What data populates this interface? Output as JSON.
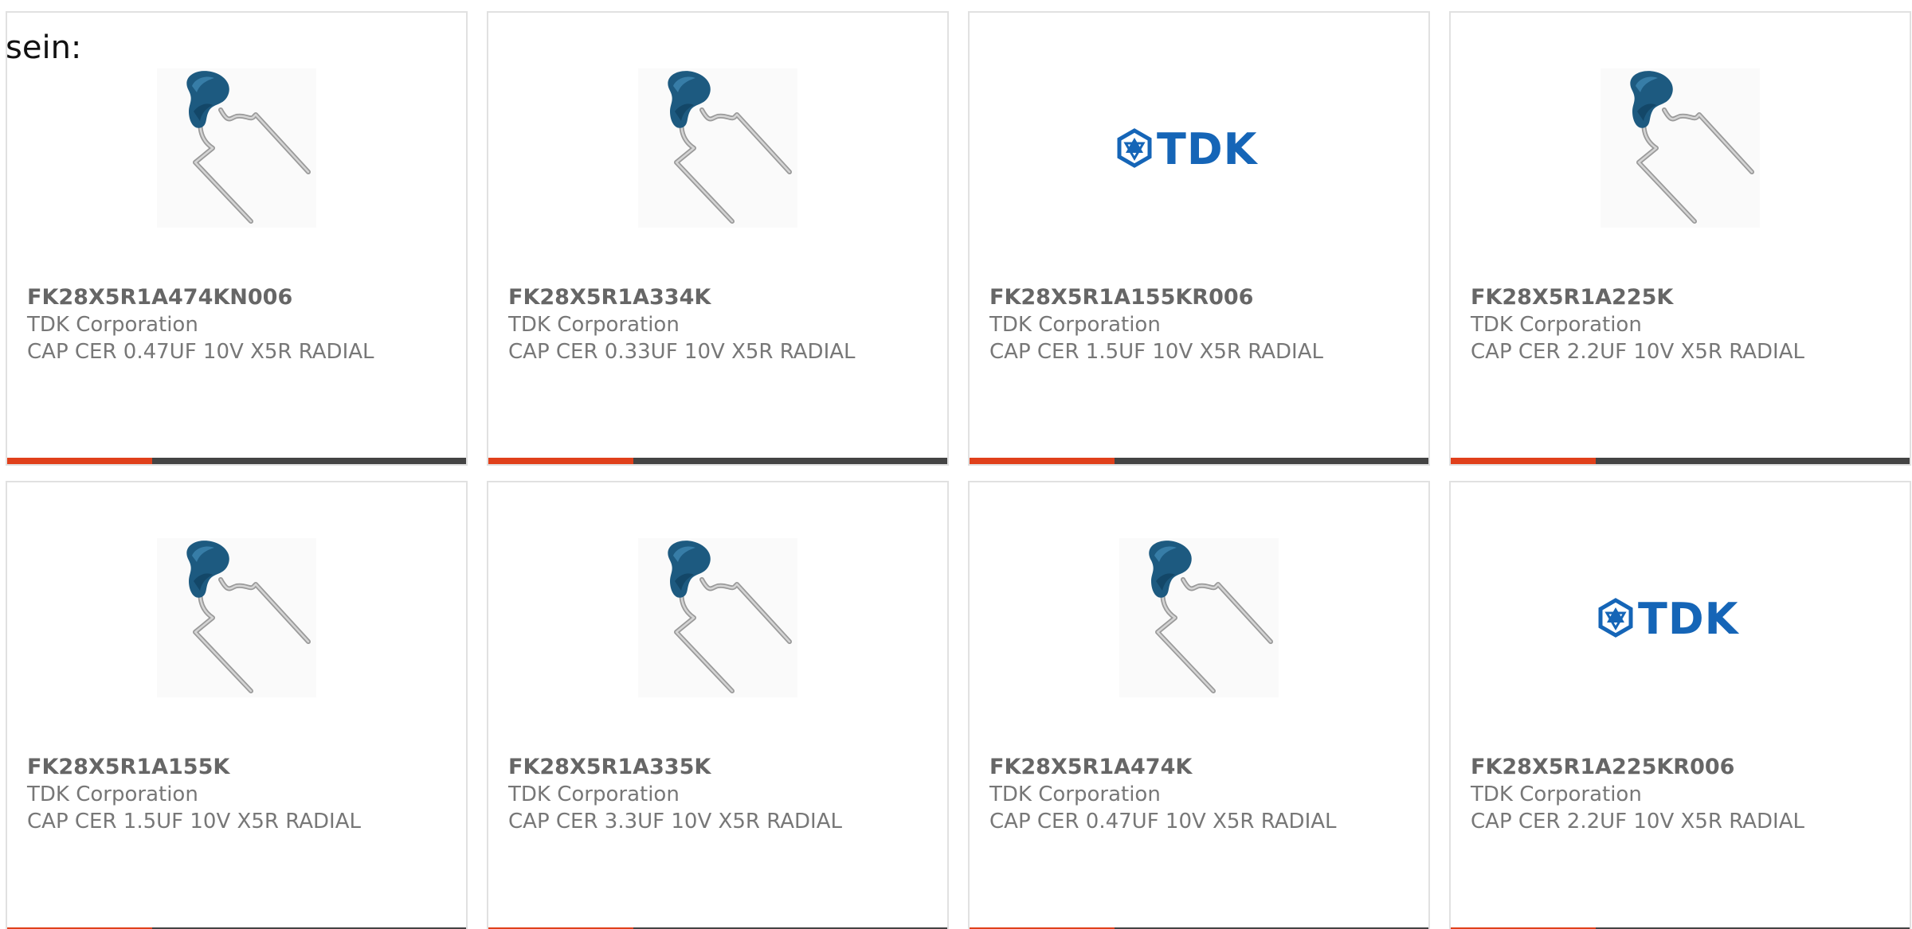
{
  "intro_text": "sein:",
  "colors": {
    "accent_bar": "#e0401b",
    "bar": "#444444",
    "tdk_blue": "#1565b7",
    "capacitor_body": "#1d5a80"
  },
  "products": [
    {
      "part_number": "FK28X5R1A474KN006",
      "manufacturer": "TDK Corporation",
      "description": "CAP CER 0.47UF 10V X5R RADIAL",
      "image": "capacitor-image"
    },
    {
      "part_number": "FK28X5R1A334K",
      "manufacturer": "TDK Corporation",
      "description": "CAP CER 0.33UF 10V X5R RADIAL",
      "image": "capacitor-image"
    },
    {
      "part_number": "FK28X5R1A155KR006",
      "manufacturer": "TDK Corporation",
      "description": "CAP CER 1.5UF 10V X5R RADIAL",
      "image": "tdk-logo",
      "logo_text": "TDK"
    },
    {
      "part_number": "FK28X5R1A225K",
      "manufacturer": "TDK Corporation",
      "description": "CAP CER 2.2UF 10V X5R RADIAL",
      "image": "capacitor-image"
    },
    {
      "part_number": "FK28X5R1A155K",
      "manufacturer": "TDK Corporation",
      "description": "CAP CER 1.5UF 10V X5R RADIAL",
      "image": "capacitor-image"
    },
    {
      "part_number": "FK28X5R1A335K",
      "manufacturer": "TDK Corporation",
      "description": "CAP CER 3.3UF 10V X5R RADIAL",
      "image": "capacitor-image"
    },
    {
      "part_number": "FK28X5R1A474K",
      "manufacturer": "TDK Corporation",
      "description": "CAP CER 0.47UF 10V X5R RADIAL",
      "image": "capacitor-image"
    },
    {
      "part_number": "FK28X5R1A225KR006",
      "manufacturer": "TDK Corporation",
      "description": "CAP CER 2.2UF 10V X5R RADIAL",
      "image": "tdk-logo",
      "logo_text": "TDK"
    }
  ]
}
